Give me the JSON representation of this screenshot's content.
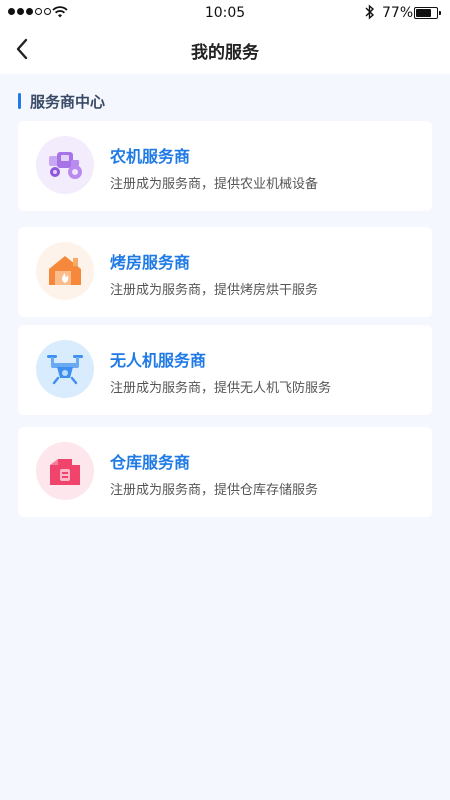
{
  "status_bar": {
    "time": "10:05",
    "battery_percent": "77%",
    "battery_level": 0.77
  },
  "nav": {
    "title": "我的服务"
  },
  "section": {
    "title": "服务商中心"
  },
  "cards": [
    {
      "title": "农机服务商",
      "desc": "注册成为服务商，提供农业机械设备",
      "icon": "tractor-icon",
      "color": "#a774e8"
    },
    {
      "title": "烤房服务商",
      "desc": "注册成为服务商，提供烤房烘干服务",
      "icon": "fire-house-icon",
      "color": "#f5883a"
    },
    {
      "title": "无人机服务商",
      "desc": "注册成为服务商，提供无人机飞防服务",
      "icon": "drone-icon",
      "color": "#3f8ff0"
    },
    {
      "title": "仓库服务商",
      "desc": "注册成为服务商，提供仓库存储服务",
      "icon": "warehouse-icon",
      "color": "#f0446c"
    }
  ],
  "colors": {
    "accent": "#1f7ae6",
    "background": "#f4f8fe"
  }
}
